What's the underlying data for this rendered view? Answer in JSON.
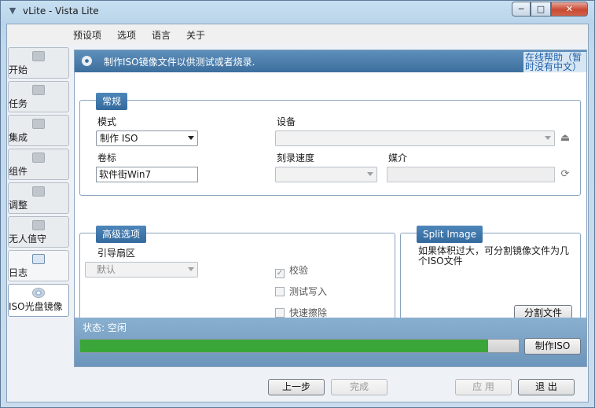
{
  "window": {
    "title": "vLite - Vista Lite",
    "minimize": "─",
    "maximize": "□",
    "close": "✕"
  },
  "menu": [
    "预设项",
    "选项",
    "语言",
    "关于"
  ],
  "sidebar": [
    {
      "label": "开始",
      "icon": "start-icon"
    },
    {
      "label": "任务",
      "icon": "tasks-icon"
    },
    {
      "label": "集成",
      "icon": "integrate-icon"
    },
    {
      "label": "组件",
      "icon": "components-icon"
    },
    {
      "label": "调整",
      "icon": "tweaks-icon"
    },
    {
      "label": "无人值守",
      "icon": "unattended-icon"
    },
    {
      "label": "日志",
      "icon": "log-icon"
    },
    {
      "label": "ISO光盘镜像",
      "icon": "iso-disc-icon"
    }
  ],
  "header": {
    "text": "制作ISO镜像文件以供测试或者烧录.",
    "help_link": "在线帮助（暂时没有中文）"
  },
  "general": {
    "title": "常规",
    "mode_label": "模式",
    "mode_value": "制作 ISO",
    "device_label": "设备",
    "device_value": "",
    "volume_label": "卷标",
    "volume_value": "软件街Win7",
    "burn_speed_label": "刻录速度",
    "burn_speed_value": "",
    "media_label": "媒介",
    "media_value": ""
  },
  "advanced": {
    "title": "高级选项",
    "boot_sector_label": "引导扇区",
    "boot_sector_value": "默认",
    "checks": [
      {
        "label": "校验",
        "checked": true
      },
      {
        "label": "测试写入",
        "checked": false
      },
      {
        "label": "快速擦除",
        "checked": false
      }
    ]
  },
  "split": {
    "title": "Split Image",
    "description": "如果体积过大，可分割镜像文件为几个ISO文件",
    "button": "分割文件"
  },
  "status": {
    "text": "状态: 空闲",
    "make_iso_button": "制作ISO",
    "progress_percent": 93
  },
  "footer": {
    "prev": "上一步",
    "finish": "完成",
    "apply": "应 用",
    "exit": "退 出"
  },
  "colors": {
    "accent": "#3d6f9e",
    "progress": "#3aa63a"
  }
}
